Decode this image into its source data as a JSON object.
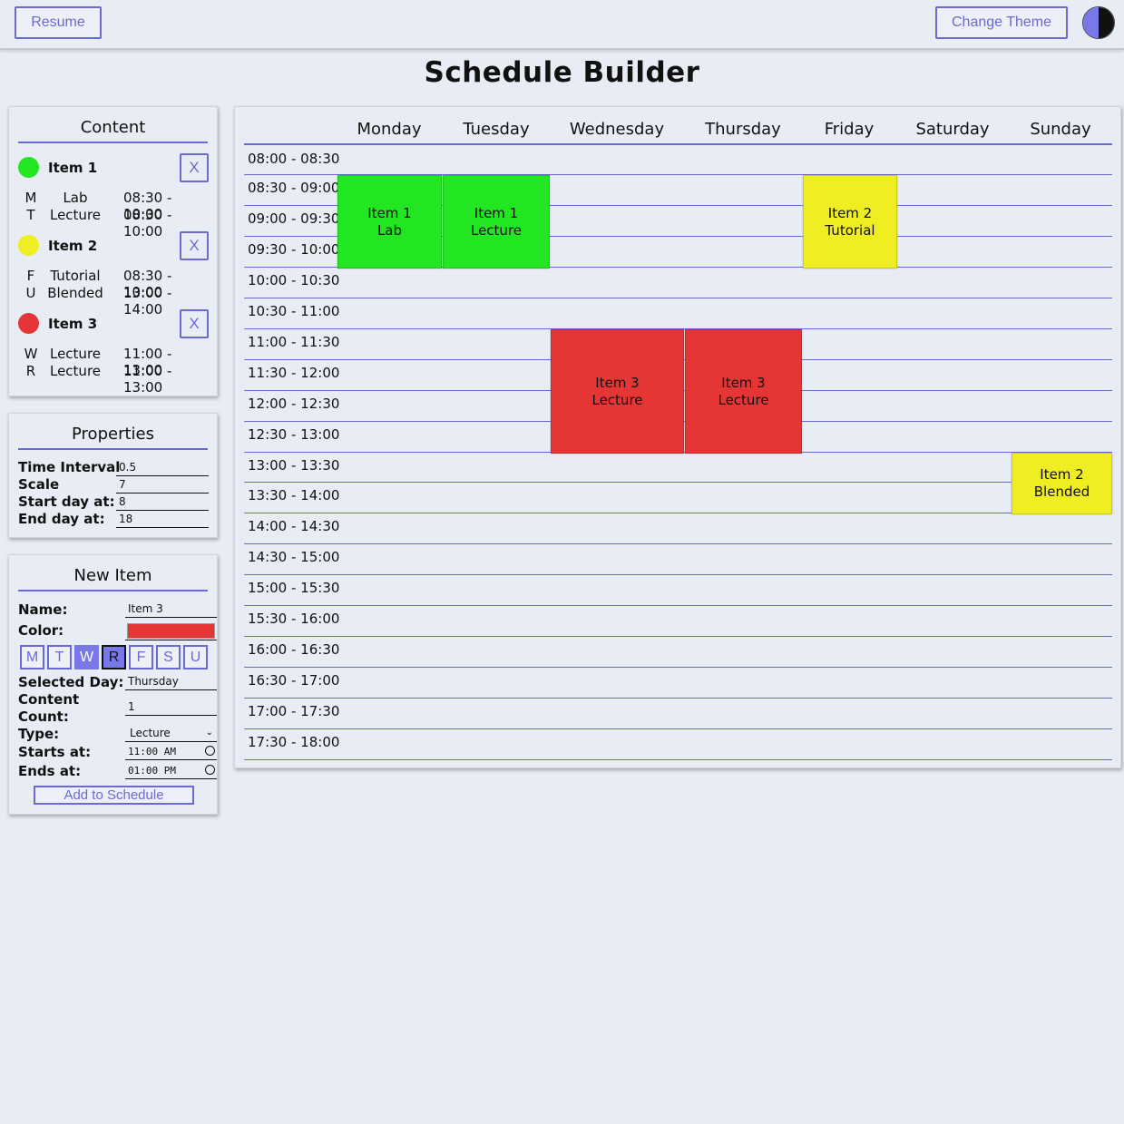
{
  "topbar": {
    "resume_label": "Resume",
    "theme_label": "Change Theme"
  },
  "page_title": "Schedule Builder",
  "content_panel": {
    "title": "Content",
    "items": [
      {
        "name": "Item 1",
        "color": "#22e622",
        "remove_label": "X",
        "entries": [
          {
            "day": "M",
            "type": "Lab",
            "time": "08:30 - 10:00"
          },
          {
            "day": "T",
            "type": "Lecture",
            "time": "08:30 - 10:00"
          }
        ]
      },
      {
        "name": "Item 2",
        "color": "#eeee22",
        "remove_label": "X",
        "entries": [
          {
            "day": "F",
            "type": "Tutorial",
            "time": "08:30 - 10:00"
          },
          {
            "day": "U",
            "type": "Blended",
            "time": "13:00 - 14:00"
          }
        ]
      },
      {
        "name": "Item 3",
        "color": "#e53535",
        "remove_label": "X",
        "entries": [
          {
            "day": "W",
            "type": "Lecture",
            "time": "11:00 - 13:00"
          },
          {
            "day": "R",
            "type": "Lecture",
            "time": "11:00 - 13:00"
          }
        ]
      }
    ]
  },
  "properties_panel": {
    "title": "Properties",
    "time_interval": {
      "label": "Time Interval",
      "value": "0.5"
    },
    "scale": {
      "label": "Scale",
      "value": "7"
    },
    "start_day": {
      "label": "Start day at:",
      "value": "8"
    },
    "end_day": {
      "label": "End day at:",
      "value": "18"
    }
  },
  "new_item_panel": {
    "title": "New Item",
    "name_label": "Name:",
    "name_value": "Item 3",
    "color_label": "Color:",
    "color_value": "#e53535",
    "day_buttons": [
      "M",
      "T",
      "W",
      "R",
      "F",
      "S",
      "U"
    ],
    "selected_day_label": "Selected Day:",
    "selected_day_value": "Thursday",
    "content_count_label_1": "Content",
    "content_count_label_2": "Count:",
    "content_count_value": "1",
    "type_label": "Type:",
    "type_value": "Lecture",
    "starts_label": "Starts at:",
    "starts_value": "11:00 AM",
    "ends_label": "Ends at:",
    "ends_value": "01:00 PM",
    "add_label": "Add to Schedule"
  },
  "schedule": {
    "days": [
      "Monday",
      "Tuesday",
      "Wednesday",
      "Thursday",
      "Friday",
      "Saturday",
      "Sunday"
    ],
    "times": [
      "08:00 - 08:30",
      "08:30 - 09:00",
      "09:00 - 09:30",
      "09:30 - 10:00",
      "10:00 - 10:30",
      "10:30 - 11:00",
      "11:00 - 11:30",
      "11:30 - 12:00",
      "12:00 - 12:30",
      "12:30 - 13:00",
      "13:00 - 13:30",
      "13:30 - 14:00",
      "14:00 - 14:30",
      "14:30 - 15:00",
      "15:00 - 15:30",
      "15:30 - 16:00",
      "16:00 - 16:30",
      "16:30 - 17:00",
      "17:00 - 17:30",
      "17:30 - 18:00"
    ],
    "blocks": [
      {
        "name": "Item 1",
        "type": "Lab",
        "day": "Monday",
        "start": "08:30",
        "end": "10:00",
        "color": "#22e622"
      },
      {
        "name": "Item 1",
        "type": "Lecture",
        "day": "Tuesday",
        "start": "08:30",
        "end": "10:00",
        "color": "#22e622"
      },
      {
        "name": "Item 2",
        "type": "Tutorial",
        "day": "Friday",
        "start": "08:30",
        "end": "10:00",
        "color": "#eeee22"
      },
      {
        "name": "Item 3",
        "type": "Lecture",
        "day": "Wednesday",
        "start": "11:00",
        "end": "13:00",
        "color": "#e53535"
      },
      {
        "name": "Item 3",
        "type": "Lecture",
        "day": "Thursday",
        "start": "11:00",
        "end": "13:00",
        "color": "#e53535"
      },
      {
        "name": "Item 2",
        "type": "Blended",
        "day": "Sunday",
        "start": "13:00",
        "end": "14:00",
        "color": "#eeee22"
      }
    ]
  }
}
